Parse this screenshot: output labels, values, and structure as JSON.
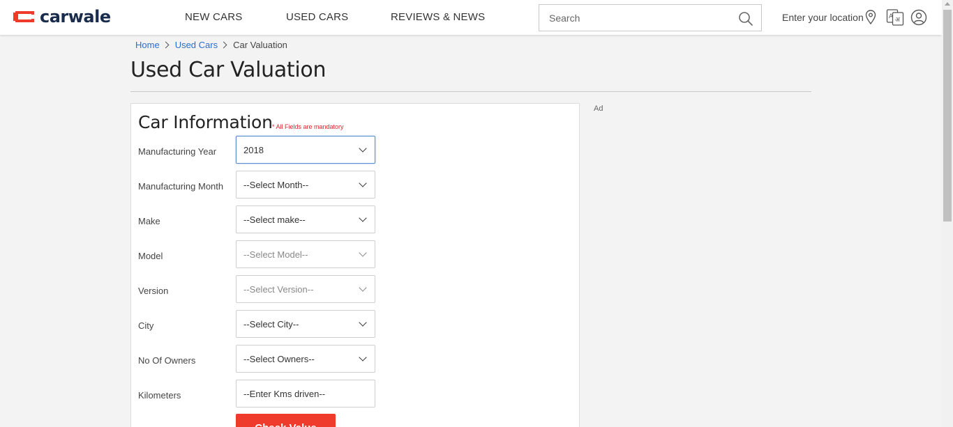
{
  "brand": {
    "name": "carwale",
    "logo_color": "#ef3b2c",
    "text_color": "#1a2c4c"
  },
  "nav": [
    {
      "label": "NEW CARS"
    },
    {
      "label": "USED CARS"
    },
    {
      "label": "REVIEWS & NEWS"
    }
  ],
  "search": {
    "placeholder": "Search",
    "icon": "search-icon"
  },
  "header_right": {
    "location_label": "Enter your location",
    "location_icon": "map-pin-icon",
    "language_icon": "translate-icon",
    "user_icon": "user-icon"
  },
  "breadcrumb": [
    {
      "label": "Home"
    },
    {
      "label": "Used Cars"
    },
    {
      "label": "Car Valuation"
    }
  ],
  "page_title": "Used Car Valuation",
  "form": {
    "title": "Car Information",
    "mandatory_note": "* All Fields are mandatory",
    "fields": [
      {
        "label": "Manufacturing Year",
        "value": "2018"
      },
      {
        "label": "Manufacturing Month",
        "value": "--Select Month--"
      },
      {
        "label": "Make",
        "value": "--Select make--"
      },
      {
        "label": "Model",
        "value": "--Select Model--"
      },
      {
        "label": "Version",
        "value": "--Select Version--"
      },
      {
        "label": "City",
        "value": "--Select City--"
      },
      {
        "label": "No Of Owners",
        "value": "--Select Owners--"
      },
      {
        "label": "Kilometers",
        "placeholder": "--Enter Kms driven--"
      }
    ],
    "submit_label": "Check Value",
    "submit_color": "#ef3b2c"
  },
  "ad_label": "Ad",
  "colors": {
    "link": "#2a6fc9",
    "mandatory": "#e0202a",
    "background": "#f3f3f3"
  }
}
